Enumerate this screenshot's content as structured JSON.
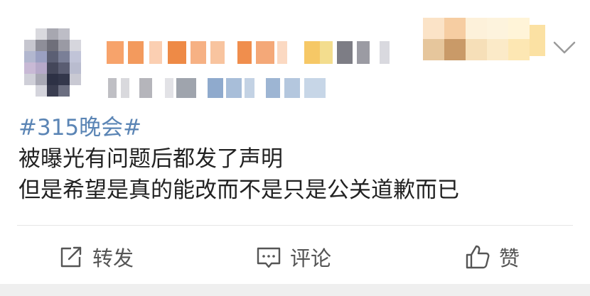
{
  "post": {
    "topic": "#315晚会#",
    "lines": [
      "被曝光有问题后都发了声明",
      "但是希望是真的能改而不是只是公关道歉而已"
    ]
  },
  "actions": {
    "repost": {
      "label": "转发",
      "icon": "share-icon"
    },
    "comment": {
      "label": "评论",
      "icon": "comment-icon"
    },
    "like": {
      "label": "赞",
      "icon": "thumbs-up-icon"
    }
  },
  "header": {
    "avatar": "pixelated",
    "username": "pixelated",
    "meta": "pixelated",
    "badge": "pixelated",
    "menu_icon": "chevron-down-icon"
  },
  "colors": {
    "topic": "#5b85b5",
    "text": "#222222",
    "action_text": "#555555",
    "page_bg": "#efefef",
    "card_bg": "#ffffff"
  }
}
